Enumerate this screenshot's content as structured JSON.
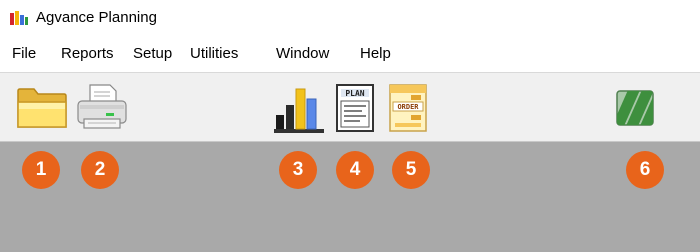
{
  "window": {
    "title": "Agvance Planning",
    "icon": "bar-chart-app-icon"
  },
  "menu": {
    "items": [
      {
        "id": "file",
        "label": "File"
      },
      {
        "id": "reports",
        "label": "Reports"
      },
      {
        "id": "setup",
        "label": "Setup"
      },
      {
        "id": "utilities",
        "label": "Utilities"
      },
      {
        "id": "window",
        "label": "Window"
      },
      {
        "id": "help",
        "label": "Help"
      }
    ]
  },
  "toolbar": {
    "buttons": [
      {
        "id": "open",
        "icon": "folder-icon"
      },
      {
        "id": "print",
        "icon": "printer-icon"
      },
      {
        "id": "reports",
        "icon": "bar-chart-icon"
      },
      {
        "id": "plan",
        "icon": "plan-document-icon",
        "icon_text": "PLAN"
      },
      {
        "id": "order",
        "icon": "order-document-icon",
        "icon_text": "ORDER"
      },
      {
        "id": "sync",
        "icon": "striped-green-icon"
      }
    ]
  },
  "callouts": [
    "1",
    "2",
    "3",
    "4",
    "5",
    "6"
  ],
  "colors": {
    "callout": "#e8641b",
    "workspace": "#a9a9a9",
    "toolbar": "#f0f0f0"
  }
}
